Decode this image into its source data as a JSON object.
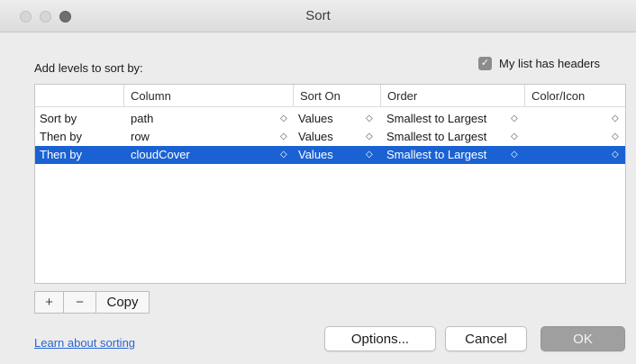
{
  "window": {
    "title": "Sort"
  },
  "header": {
    "instruction": "Add levels to sort by:",
    "headers_checkbox_label": "My list has headers",
    "headers_checkbox_checked": true,
    "check_glyph": "✓"
  },
  "table": {
    "columns": [
      "Column",
      "Sort On",
      "Order",
      "Color/Icon"
    ],
    "rows": [
      {
        "lead": "Sort by",
        "column": "path",
        "sort_on": "Values",
        "order": "Smallest to Largest",
        "color_icon": "",
        "selected": false
      },
      {
        "lead": "Then by",
        "column": "row",
        "sort_on": "Values",
        "order": "Smallest to Largest",
        "color_icon": "",
        "selected": false
      },
      {
        "lead": "Then by",
        "column": "cloudCover",
        "sort_on": "Values",
        "order": "Smallest to Largest",
        "color_icon": "",
        "selected": true
      }
    ],
    "stepper_glyph": "◇",
    "selection_color": "#1a62d4"
  },
  "toolbar": {
    "add_label": "+",
    "remove_label": "−",
    "copy_label": "Copy"
  },
  "footer": {
    "learn_link": "Learn about sorting",
    "options_label": "Options...",
    "cancel_label": "Cancel",
    "ok_label": "OK"
  },
  "colors": {
    "link": "#2864d2",
    "ok_disabled": "#9f9f9f"
  }
}
